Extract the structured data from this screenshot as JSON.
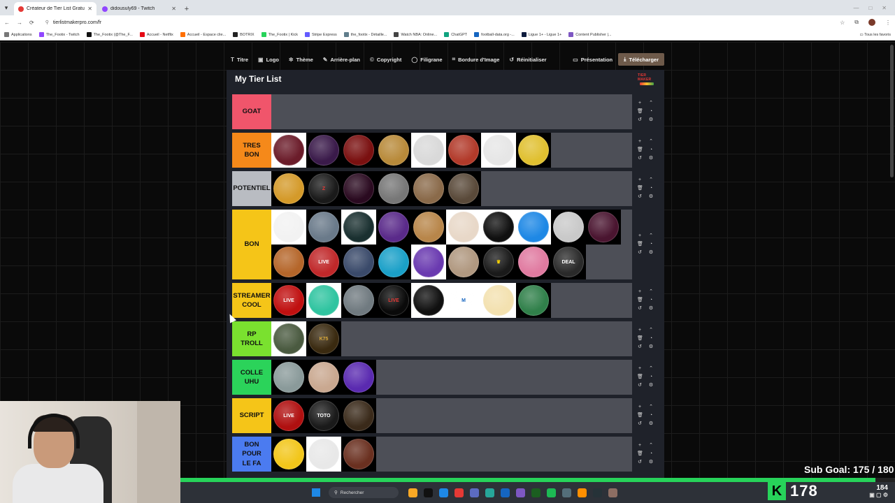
{
  "browser": {
    "tabs": [
      {
        "title": "Créateur de Tier List Gratuit - T",
        "active": true,
        "color": "#e53935"
      },
      {
        "title": "didousuly69 - Twitch",
        "active": false,
        "color": "#9146ff"
      }
    ],
    "url": "tierlistmakerpro.com/fr",
    "bookmarks": [
      {
        "label": "Applications",
        "color": "#777777"
      },
      {
        "label": "The_Footix - Twitch",
        "color": "#9146ff"
      },
      {
        "label": "The_Footix (@The_F...",
        "color": "#111111"
      },
      {
        "label": "Accueil - Netflix",
        "color": "#e50914"
      },
      {
        "label": "Accueil - Espace clie...",
        "color": "#ff6f00"
      },
      {
        "label": "BOTRIX",
        "color": "#222222"
      },
      {
        "label": "The_Footix | Kick",
        "color": "#27d35a"
      },
      {
        "label": "Stripe Express",
        "color": "#635bff"
      },
      {
        "label": "the_footix - Détaille...",
        "color": "#607d8b"
      },
      {
        "label": "Watch NBA: Online...",
        "color": "#444444"
      },
      {
        "label": "ChatGPT",
        "color": "#10a37f"
      },
      {
        "label": "football-data.org -...",
        "color": "#1565c0"
      },
      {
        "label": "Ligue 1+ - Ligue 1+",
        "color": "#0d1b3d"
      },
      {
        "label": "Content Publisher |...",
        "color": "#7e57c2"
      }
    ],
    "all_favorites": "Tous les favoris"
  },
  "toolbar": {
    "items": [
      {
        "label": "Titre",
        "icon": "T"
      },
      {
        "label": "Logo",
        "icon": "▣"
      },
      {
        "label": "Thème",
        "icon": "✲"
      },
      {
        "label": "Arrière-plan",
        "icon": "✎"
      },
      {
        "label": "Copyright",
        "icon": "©"
      },
      {
        "label": "Filigrane",
        "icon": "◯"
      },
      {
        "label": "Bordure d'Image",
        "icon": "⌗"
      },
      {
        "label": "Réinitialiser",
        "icon": "↺"
      }
    ],
    "presentation": "Présentation",
    "download": "Télécharger"
  },
  "tierlist": {
    "title": "My Tier List",
    "logo_text": "TIER MAKER",
    "tiers": [
      {
        "label": "GOAT",
        "color": "#f0556b",
        "items": []
      },
      {
        "label": "TRES\nBON",
        "color": "#f5891a",
        "items": [
          {
            "bg": "#6b1c2a",
            "tile": "white"
          },
          {
            "bg": "#3a1a4a"
          },
          {
            "bg": "#7a1010"
          },
          {
            "bg": "#b88a3a"
          },
          {
            "bg": "#d9d9d9",
            "tile": "white"
          },
          {
            "bg": "#b23a2a"
          },
          {
            "bg": "#e6e6e6",
            "tile": "white"
          },
          {
            "bg": "#e0c030"
          }
        ]
      },
      {
        "label": "POTENTIEL",
        "color": "#b9bcc2",
        "items": [
          {
            "bg": "#d49a2a"
          },
          {
            "bg": "#1a1a1a",
            "text": "Z",
            "textColor": "#e53935"
          },
          {
            "bg": "#2a0a20"
          },
          {
            "bg": "#777777"
          },
          {
            "bg": "#8a6a4a"
          },
          {
            "bg": "#5a4a3a"
          }
        ]
      },
      {
        "label": "BON",
        "color": "#f5c518",
        "items": [
          {
            "bg": "#f2f2f2",
            "tile": "white"
          },
          {
            "bg": "#6a7a8a"
          },
          {
            "bg": "#1a3030",
            "tile": "white"
          },
          {
            "bg": "#5a2a8a"
          },
          {
            "bg": "#b8864a"
          },
          {
            "bg": "#e8d8c8",
            "tile": "white"
          },
          {
            "bg": "#101010",
            "tile": "white"
          },
          {
            "bg": "#1e88e5",
            "tile": "white"
          },
          {
            "bg": "#c9c9c9"
          },
          {
            "bg": "#4a1530"
          },
          {
            "bg": "#b5662a"
          },
          {
            "bg": "#c0282a",
            "text": "LIVE",
            "textColor": "#ffffff"
          },
          {
            "bg": "#3a4a6a"
          },
          {
            "bg": "#1aa0c8"
          },
          {
            "bg": "#6a3ab0",
            "tile": "white"
          },
          {
            "bg": "#b09880"
          },
          {
            "bg": "#1a1a1a",
            "text": "♛",
            "textColor": "#ffd600"
          },
          {
            "bg": "#e07aa0"
          },
          {
            "bg": "#2a2a2a",
            "text": "DEAL",
            "textColor": "#ffffff"
          }
        ]
      },
      {
        "label": "STREAMER\nCOOL",
        "color": "#f5c518",
        "items": [
          {
            "bg": "#c01010",
            "text": "LIVE",
            "textColor": "#ffffff"
          },
          {
            "bg": "#2fc4a0",
            "tile": "white"
          },
          {
            "bg": "#707a80"
          },
          {
            "bg": "#0a0a0a",
            "text": "LIVE",
            "textColor": "#e53935"
          },
          {
            "bg": "#101010",
            "tile": "white"
          },
          {
            "bg": "#ffffff",
            "tile": "white",
            "text": "M",
            "textColor": "#1565c0"
          },
          {
            "bg": "#f3e1b0",
            "tile": "white"
          },
          {
            "bg": "#30804a"
          }
        ]
      },
      {
        "label": "RP\nTROLL",
        "color": "#7ae12f",
        "items": [
          {
            "bg": "#4a5a40",
            "tile": "white"
          },
          {
            "bg": "#3a2a10",
            "text": "K75",
            "textColor": "#d9a93a"
          }
        ]
      },
      {
        "label": "COLLE\nUHU",
        "color": "#2bd35a",
        "items": [
          {
            "bg": "#8a9a9a"
          },
          {
            "bg": "#c9a890"
          },
          {
            "bg": "#5a2ab0"
          }
        ]
      },
      {
        "label": "SCRIPT",
        "color": "#f5c518",
        "items": [
          {
            "bg": "#b01010",
            "text": "LIVE",
            "textColor": "#ffffff"
          },
          {
            "bg": "#1a1a1a",
            "text": "TOTO",
            "textColor": "#ffffff"
          },
          {
            "bg": "#3a2a1a"
          }
        ]
      },
      {
        "label": "BON\nPOUR\nLE FA",
        "color": "#4b7bf0",
        "items": [
          {
            "bg": "#f2c61a"
          },
          {
            "bg": "#e8e8e8",
            "tile": "white"
          },
          {
            "bg": "#6a3020"
          }
        ]
      }
    ]
  },
  "taskbar": {
    "search_placeholder": "Rechercher",
    "apps": [
      "#f9a825",
      "#111111",
      "#1e88e5",
      "#e53935",
      "#5c6bc0",
      "#26a69a",
      "#1565c0",
      "#7e57c2",
      "#1b5e20",
      "#1db954",
      "#546e7a",
      "#ff8f00",
      "#263238",
      "#8d6e63"
    ]
  },
  "overlay": {
    "sub_goal_label": "Sub Goal:",
    "sub_goal_current": 175,
    "sub_goal_target": 180,
    "counter": "178",
    "viewers": "184",
    "accent": "#27d35a"
  }
}
